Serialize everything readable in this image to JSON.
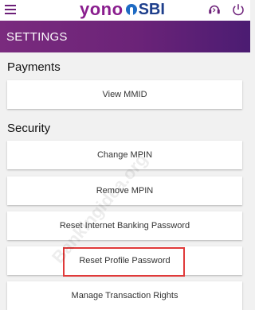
{
  "topbar": {
    "brand_left": "yono",
    "brand_right": "SBI",
    "icons": [
      "menu-icon",
      "phone-headset-icon",
      "power-icon"
    ],
    "brand_color_primary": "#8a1e8e",
    "brand_color_secondary": "#1e3f8c"
  },
  "header": {
    "title": "SETTINGS",
    "gradient_start": "#7a2b7e",
    "gradient_end": "#4b1c72"
  },
  "sections": {
    "payments": {
      "title": "Payments",
      "items": [
        "View MMID"
      ]
    },
    "security": {
      "title": "Security",
      "items": [
        "Change MPIN",
        "Remove MPIN",
        "Reset Internet Banking Password",
        "Reset Profile Password",
        "Manage Transaction Rights"
      ]
    }
  },
  "watermark": "Bankingidea.org"
}
